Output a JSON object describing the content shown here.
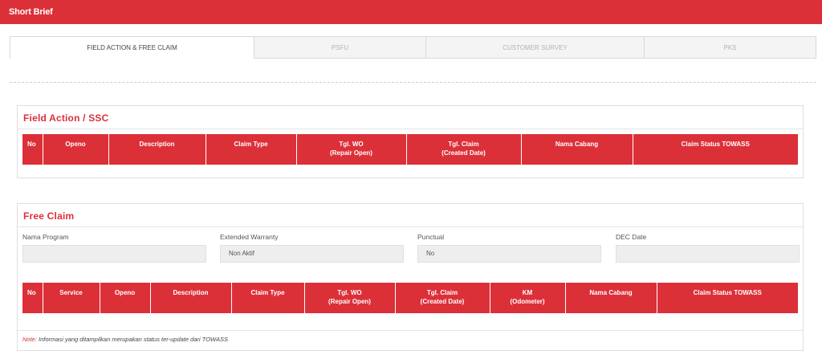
{
  "header": {
    "title": "Short Brief"
  },
  "tabs": [
    {
      "label": "FIELD ACTION & FREE CLAIM"
    },
    {
      "label": "PSFU"
    },
    {
      "label": "CUSTOMER SURVEY"
    },
    {
      "label": "PKS"
    }
  ],
  "field_action": {
    "title": "Field Action / SSC",
    "columns": [
      "No",
      "Openo",
      "Description",
      "Claim Type",
      "Tgl. WO",
      "(Repair Open)",
      "Tgl. Claim",
      "(Created Date)",
      "Nama Cabang",
      "Claim Status TOWASS"
    ]
  },
  "free_claim": {
    "title": "Free Claim",
    "fields": {
      "nama_program": {
        "label": "Nama Program",
        "value": ""
      },
      "extended_warranty": {
        "label": "Extended Warranty",
        "value": "Non Aktif"
      },
      "punctual": {
        "label": "Punctual",
        "value": "No"
      },
      "dec_date": {
        "label": "DEC Date",
        "value": ""
      }
    },
    "columns": [
      "No",
      "Service",
      "Openo",
      "Description",
      "Claim Type",
      "Tgl. WO",
      "(Repair Open)",
      "Tgl. Claim",
      "(Created Date)",
      "KM",
      "(Odometer)",
      "Nama Cabang",
      "Claim Status TOWASS"
    ],
    "note_label": "Note:",
    "note_text": "Informasi yang ditampilkan merupakan status ter-update dari TOWASS"
  },
  "colors": {
    "accent": "#dc3039"
  }
}
